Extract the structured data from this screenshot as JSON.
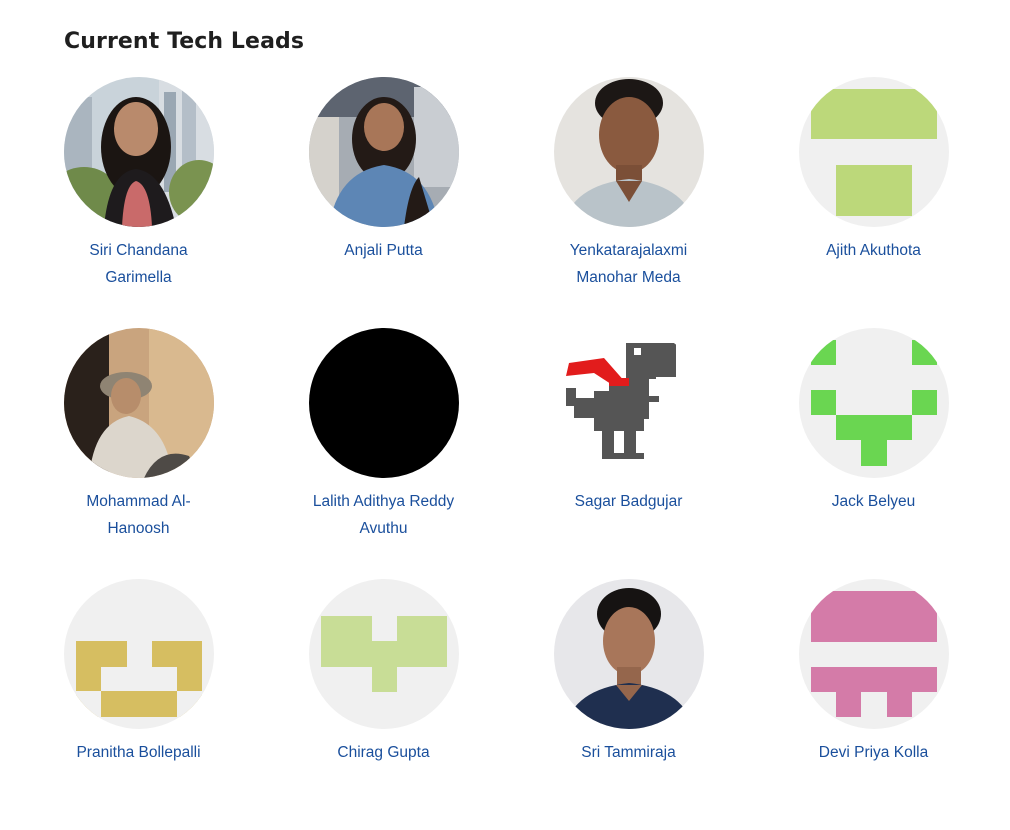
{
  "section": {
    "title": "Current Tech Leads"
  },
  "leads": [
    {
      "name": "Siri Chandana Garimella",
      "avatar": "photo-woman-city-icon"
    },
    {
      "name": "Anjali Putta",
      "avatar": "photo-woman-denim-icon"
    },
    {
      "name": "Yenkatarajalaxmi Manohar Meda",
      "avatar": "photo-man-portrait-icon"
    },
    {
      "name": "Ajith Akuthota",
      "avatar": "identicon-green-icon"
    },
    {
      "name": "Mohammad Al-Hanoosh",
      "avatar": "photo-man-sitting-icon"
    },
    {
      "name": "Lalith Adithya Reddy Avuthu",
      "avatar": "black-avatar-icon"
    },
    {
      "name": "Sagar Badgujar",
      "avatar": "pixel-dinosaur-icon"
    },
    {
      "name": "Jack Belyeu",
      "avatar": "identicon-bright-green-icon"
    },
    {
      "name": "Pranitha Bollepalli",
      "avatar": "identicon-gold-icon"
    },
    {
      "name": "Chirag Gupta",
      "avatar": "identicon-lime-icon"
    },
    {
      "name": "Sri Tammiraja",
      "avatar": "photo-man-glasses-icon"
    },
    {
      "name": "Devi Priya Kolla",
      "avatar": "identicon-pink-icon"
    }
  ],
  "colors": {
    "link": "#1a4f9c",
    "identicon_bg": "#f0f0f0",
    "green": "#bcd87a",
    "bright_green": "#6ad651",
    "gold": "#d6be61",
    "lime": "#c8dd96",
    "pink": "#d47ba8"
  }
}
